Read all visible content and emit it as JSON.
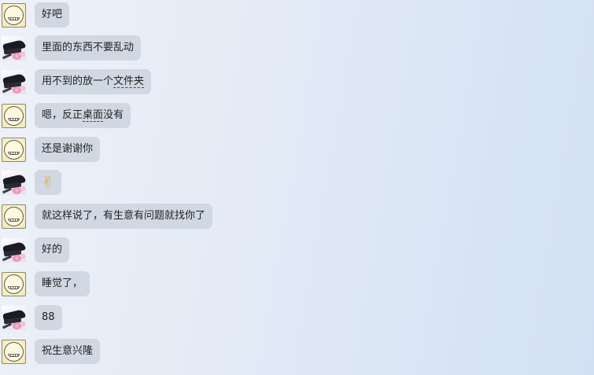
{
  "conversation": [
    {
      "sender": "self",
      "text": "好吧"
    },
    {
      "sender": "other",
      "text": "里面的东西不要乱动"
    },
    {
      "sender": "other",
      "pre": "用不到的放一个",
      "dashed": "文件夹",
      "post": ""
    },
    {
      "sender": "self",
      "pre": "嗯，反正",
      "dashed": "桌面",
      "post": "没有"
    },
    {
      "sender": "self",
      "text": "还是谢谢你"
    },
    {
      "sender": "other",
      "emoji": "✌"
    },
    {
      "sender": "self",
      "text": "就这样说了，有生意有问题就找你了"
    },
    {
      "sender": "other",
      "text": "好的"
    },
    {
      "sender": "self",
      "text": "睡觉了，"
    },
    {
      "sender": "other",
      "text": "88"
    },
    {
      "sender": "self",
      "text": "祝生意兴隆"
    }
  ],
  "avatars": {
    "self": "smiley-face-avatar",
    "other": "black-hat-pink-flower-avatar"
  },
  "colors": {
    "bubble": "#cfd8e3",
    "text": "#222222",
    "background_left": "#eef1f8",
    "background_right": "#d3e1f4"
  }
}
